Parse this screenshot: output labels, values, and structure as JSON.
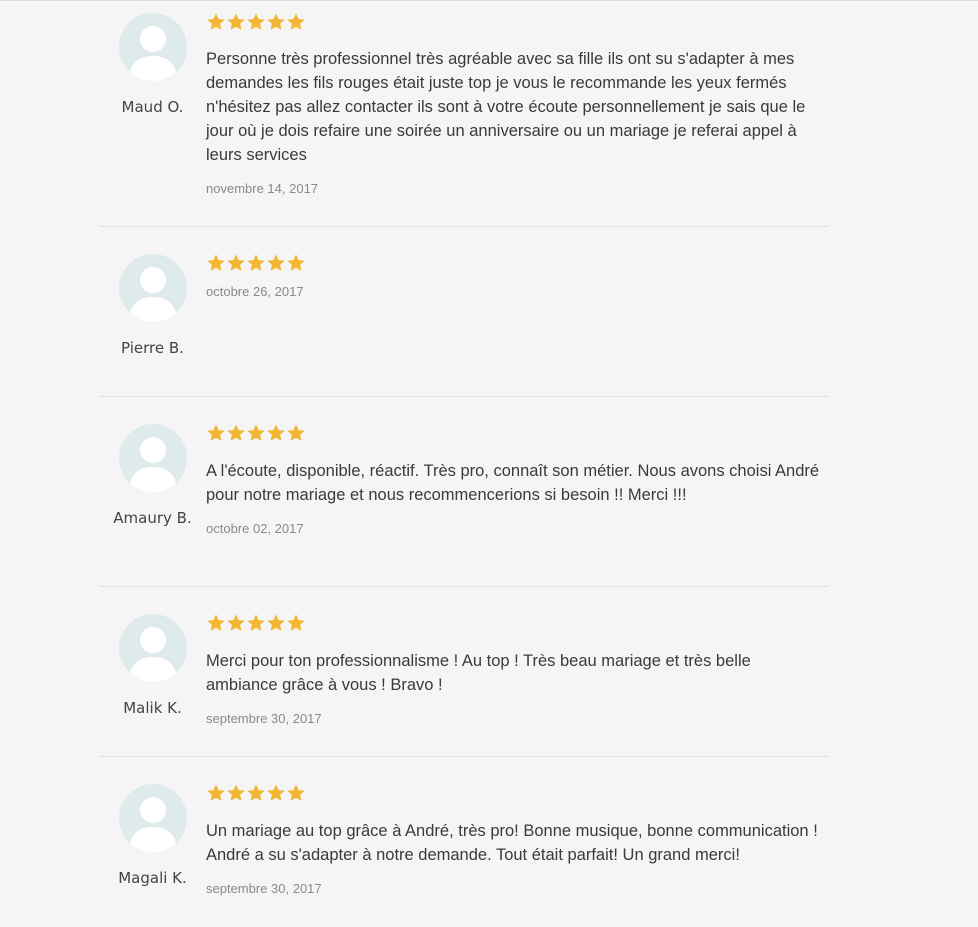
{
  "colors": {
    "star": "#f2b632",
    "avatar_bg": "#dfeaec",
    "text": "#3a3a3a",
    "date": "#8a8a8a"
  },
  "reviews": [
    {
      "author": "Maud O.",
      "rating": 5,
      "text": "Personne très professionnel très agréable avec sa fille ils ont su s'adapter à mes demandes les fils rouges était juste top je vous le recommande les yeux fermés n'hésitez pas allez contacter ils sont à votre écoute personnellement je sais que le jour où je dois refaire une soirée un anniversaire ou un mariage je referai appel à leurs services",
      "date": "novembre 14, 2017"
    },
    {
      "author": "Pierre B.",
      "rating": 5,
      "text": "",
      "date": "octobre 26, 2017"
    },
    {
      "author": "Amaury B.",
      "rating": 5,
      "text": "A l'écoute, disponible, réactif. Très pro, connaît son métier. Nous avons choisi André pour notre mariage et nous recommencerions si besoin !! Merci !!!",
      "date": "octobre 02, 2017"
    },
    {
      "author": "Malik K.",
      "rating": 5,
      "text": "Merci pour ton professionnalisme ! Au top ! Très beau mariage et très belle ambiance grâce à vous ! Bravo !",
      "date": "septembre 30, 2017"
    },
    {
      "author": "Magali K.",
      "rating": 5,
      "text": "Un mariage au top grâce à André, très pro! Bonne musique, bonne communication ! André a su s'adapter à notre demande. Tout était parfait! Un grand merci!",
      "date": "septembre 30, 2017"
    }
  ]
}
